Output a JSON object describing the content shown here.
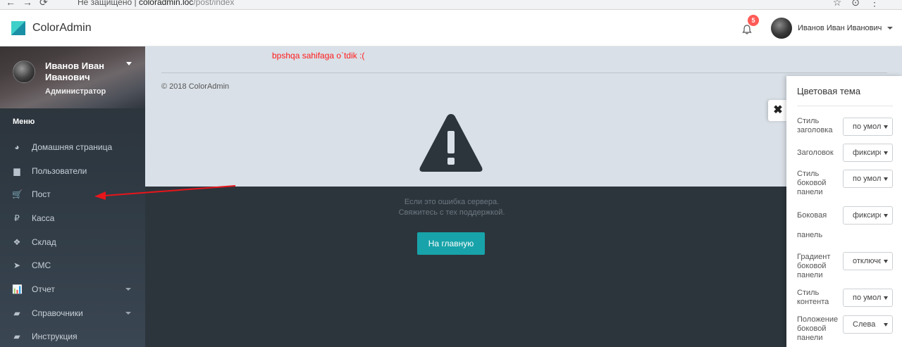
{
  "browser": {
    "nav_glyphs": "←→⟳",
    "url_prefix": "Не защищено |",
    "url_host": "coloradmin.loc",
    "url_path": "/post/index",
    "right_glyphs": "☆⊙⋮"
  },
  "header": {
    "brand": "ColorAdmin",
    "notification_count": "5",
    "user_name": "Иванов Иван Иванович"
  },
  "sidebar": {
    "profile_name": "Иванов Иван Иванович",
    "profile_role": "Администратор",
    "menu_header": "Меню",
    "items": [
      {
        "label": "Домашняя страница",
        "icon": "dashboard-icon",
        "glyph": "◕"
      },
      {
        "label": "Пользователи",
        "icon": "users-icon",
        "glyph": "▆"
      },
      {
        "label": "Пост",
        "icon": "cart-icon",
        "glyph": "🛒"
      },
      {
        "label": "Касса",
        "icon": "ruble-icon",
        "glyph": "₽"
      },
      {
        "label": "Склад",
        "icon": "cubes-icon",
        "glyph": "❖"
      },
      {
        "label": "СМС",
        "icon": "send-icon",
        "glyph": "➤"
      },
      {
        "label": "Отчет",
        "icon": "chart-icon",
        "glyph": "📊"
      },
      {
        "label": "Справочники",
        "icon": "book-icon",
        "glyph": "▰"
      },
      {
        "label": "Инструкция",
        "icon": "book-icon",
        "glyph": "▰"
      }
    ]
  },
  "content": {
    "annotation": "bpshqa sahifaga o`tdik :(",
    "footer": "© 2018 ColorAdmin",
    "error_line1": "Если это ошибка сервера.",
    "error_line2": "Свяжитесь с тех поддержкой.",
    "home_button": "На главную"
  },
  "theme_panel": {
    "close": "✖",
    "title": "Цветовая тема",
    "options": [
      {
        "label": "Стиль заголовка",
        "value": "по умолчанию"
      },
      {
        "label": "Заголовок",
        "value": "фиксированный"
      },
      {
        "label": "Стиль боковой панели",
        "value": "по умолчанию"
      },
      {
        "label": "Боковая",
        "value": "фиксированная"
      },
      {
        "label": "панель",
        "value": ""
      },
      {
        "label": "Градиент боковой панели",
        "value": "отключен"
      },
      {
        "label": "Стиль контента",
        "value": "по умолчанию"
      },
      {
        "label": "Положение боковой панели",
        "value": "Слева"
      }
    ]
  },
  "colors": {
    "accent": "#17a3a9",
    "badge": "#ff5b57",
    "annotation": "#ff1a1a",
    "sidebar_bg": "#2d353c"
  }
}
